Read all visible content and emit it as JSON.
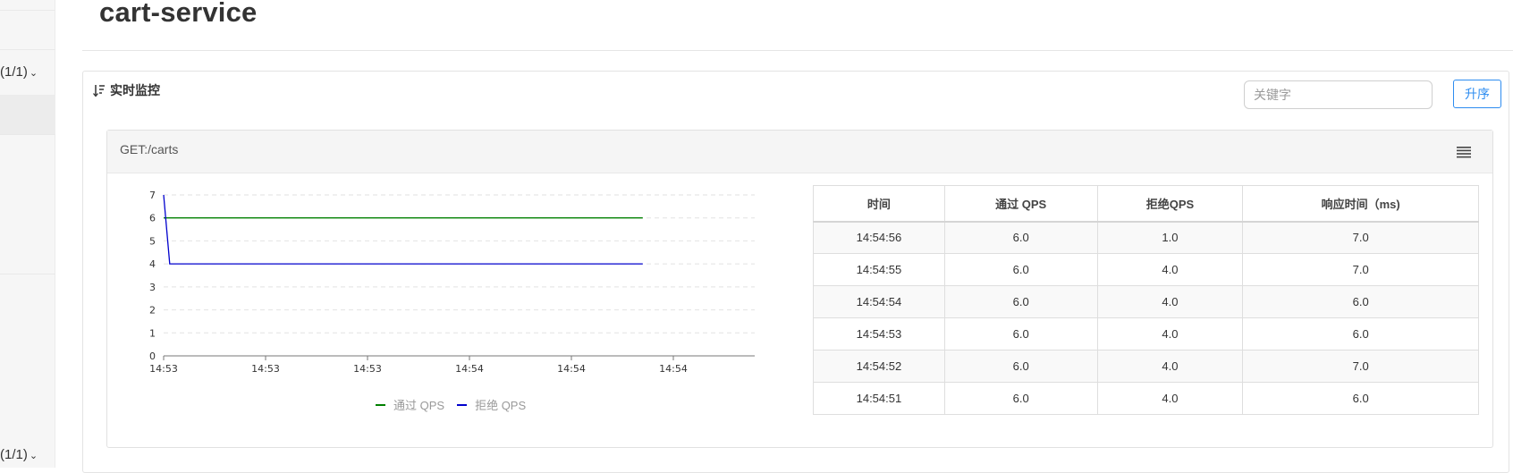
{
  "sidebar": {
    "pager_top": "(1/1)",
    "pager_bottom": "(1/1)"
  },
  "page": {
    "title": "cart-service"
  },
  "monitor": {
    "heading": "实时监控",
    "keyword_placeholder": "关键字",
    "sort_label": "升序"
  },
  "resource": {
    "title": "GET:/carts"
  },
  "colors": {
    "pass": "#008000",
    "block": "#0000cd",
    "accent": "#2d8cf0"
  },
  "chart_data": {
    "type": "line",
    "x_ticks": [
      "14:53",
      "14:53",
      "14:53",
      "14:54",
      "14:54",
      "14:54"
    ],
    "y_ticks": [
      0,
      1,
      2,
      3,
      4,
      5,
      6,
      7
    ],
    "ylim": [
      0,
      7
    ],
    "grid": true,
    "legend_position": "bottom",
    "series": [
      {
        "name": "通过 QPS",
        "color": "#008000",
        "points": [
          [
            0,
            6
          ],
          [
            1,
            6
          ],
          [
            2,
            6
          ],
          [
            3,
            6
          ],
          [
            4,
            6
          ],
          [
            4.7,
            6
          ]
        ]
      },
      {
        "name": "拒绝 QPS",
        "color": "#0000cd",
        "points": [
          [
            0,
            7
          ],
          [
            0.06,
            4
          ],
          [
            0.15,
            4
          ],
          [
            1,
            4
          ],
          [
            2,
            4
          ],
          [
            3,
            4
          ],
          [
            4,
            4
          ],
          [
            4.7,
            4
          ]
        ]
      }
    ]
  },
  "table": {
    "headers": [
      "时间",
      "通过 QPS",
      "拒绝QPS",
      "响应时间（ms)"
    ],
    "rows": [
      [
        "14:54:56",
        "6.0",
        "1.0",
        "7.0"
      ],
      [
        "14:54:55",
        "6.0",
        "4.0",
        "7.0"
      ],
      [
        "14:54:54",
        "6.0",
        "4.0",
        "6.0"
      ],
      [
        "14:54:53",
        "6.0",
        "4.0",
        "6.0"
      ],
      [
        "14:54:52",
        "6.0",
        "4.0",
        "7.0"
      ],
      [
        "14:54:51",
        "6.0",
        "4.0",
        "6.0"
      ]
    ]
  }
}
